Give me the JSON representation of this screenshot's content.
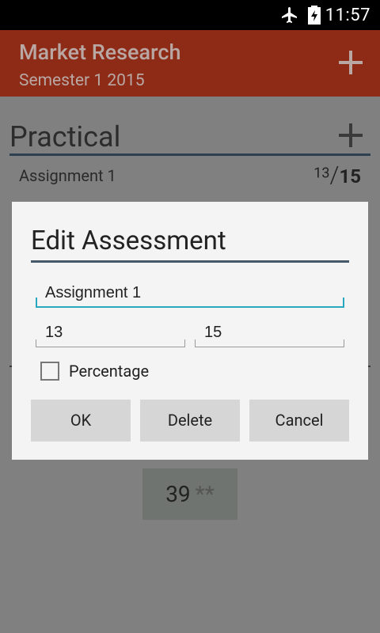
{
  "status_bar": {
    "time": "11:57",
    "icons": [
      "airplane-icon",
      "battery-charging-icon"
    ]
  },
  "action_bar": {
    "title": "Market Research",
    "subtitle": "Semester 1 2015",
    "add_icon": "plus-icon"
  },
  "content": {
    "section_title": "Practical",
    "section_add_icon": "plus-icon",
    "assessments": [
      {
        "name": "Assignment 1",
        "score": "13",
        "slash": "/",
        "total": "15"
      }
    ],
    "total_box": {
      "value": "39",
      "stars": "**"
    }
  },
  "dialog": {
    "title": "Edit Assessment",
    "name_value": "Assignment 1",
    "score_value": "13",
    "total_value": "15",
    "percentage_label": "Percentage",
    "percentage_checked": false,
    "buttons": {
      "ok": "OK",
      "delete": "Delete",
      "cancel": "Cancel"
    }
  },
  "colors": {
    "action_bar_dimmed": "#8d2b17",
    "overlay_background": "#808080",
    "dialog_background": "#f4f4f4",
    "focused_field_accent": "#2aa8c0",
    "button_background": "#d6d6d6"
  }
}
